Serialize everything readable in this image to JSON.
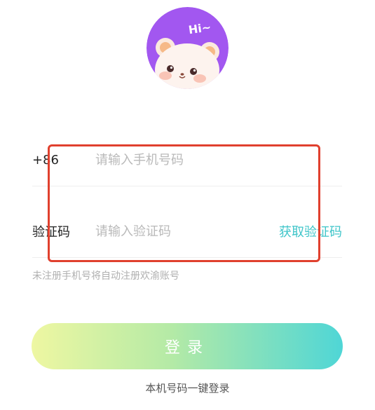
{
  "avatar": {
    "greeting": "Hi~",
    "bg_color": "#a257f0"
  },
  "phone": {
    "prefix": "+86",
    "placeholder": "请输入手机号码",
    "value": ""
  },
  "code": {
    "label": "验证码",
    "placeholder": "请输入验证码",
    "value": "",
    "get_code_label": "获取验证码"
  },
  "tip": "未注册手机号将自动注册欢渝账号",
  "login_label": "登录",
  "one_key_login_label": "本机号码一键登录",
  "colors": {
    "accent": "#3fc5c9",
    "highlight_border": "#e0402e",
    "gradient_start": "#eef7a2",
    "gradient_end": "#4fd6d6"
  }
}
